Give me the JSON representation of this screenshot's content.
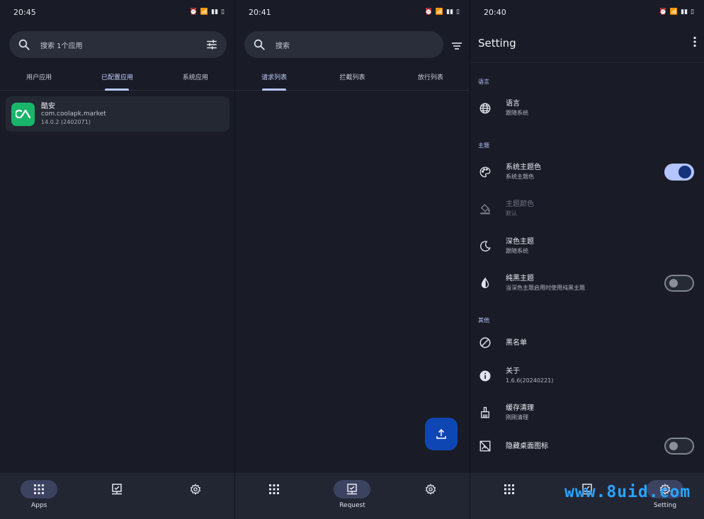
{
  "panel1": {
    "time": "20:45",
    "search_placeholder": "搜索 1个应用",
    "tabs": [
      "用户应用",
      "已配置应用",
      "系统应用"
    ],
    "app": {
      "name": "酷安",
      "package": "com.coolapk.market",
      "version": "14.0.2 (2402071)",
      "icon_color": "#18b56a"
    },
    "nav": {
      "apps_label": "Apps"
    }
  },
  "panel2": {
    "time": "20:41",
    "search_placeholder": "搜索",
    "tabs": [
      "请求列表",
      "拦截列表",
      "放行列表"
    ],
    "nav": {
      "request_label": "Request"
    }
  },
  "panel3": {
    "time": "20:40",
    "title": "Setting",
    "sections": {
      "language": "语言",
      "theme": "主题",
      "other": "其他"
    },
    "rows": {
      "language": {
        "title": "语言",
        "subtitle": "跟随系统"
      },
      "system_color": {
        "title": "系统主题色",
        "subtitle": "系统主题色",
        "enabled": true
      },
      "theme_color": {
        "title": "主题颜色",
        "subtitle": "默认"
      },
      "dark_theme": {
        "title": "深色主题",
        "subtitle": "跟随系统"
      },
      "pure_black": {
        "title": "纯黑主题",
        "subtitle": "当深色主题启用时使用纯黑主题",
        "enabled": false
      },
      "blacklist": {
        "title": "黑名单"
      },
      "about": {
        "title": "关于",
        "subtitle": "1.6.6(20240221)"
      },
      "cache": {
        "title": "缓存清理",
        "subtitle": "刚刚清理"
      },
      "hide_icon": {
        "title": "隐藏桌面图标",
        "enabled": false
      }
    },
    "nav": {
      "setting_label": "Setting"
    }
  },
  "watermark": "www.8uid.com",
  "colors": {
    "background": "#191c26",
    "accent": "#b9c7ff",
    "fab": "#0e47b3",
    "nav": "#222633"
  }
}
